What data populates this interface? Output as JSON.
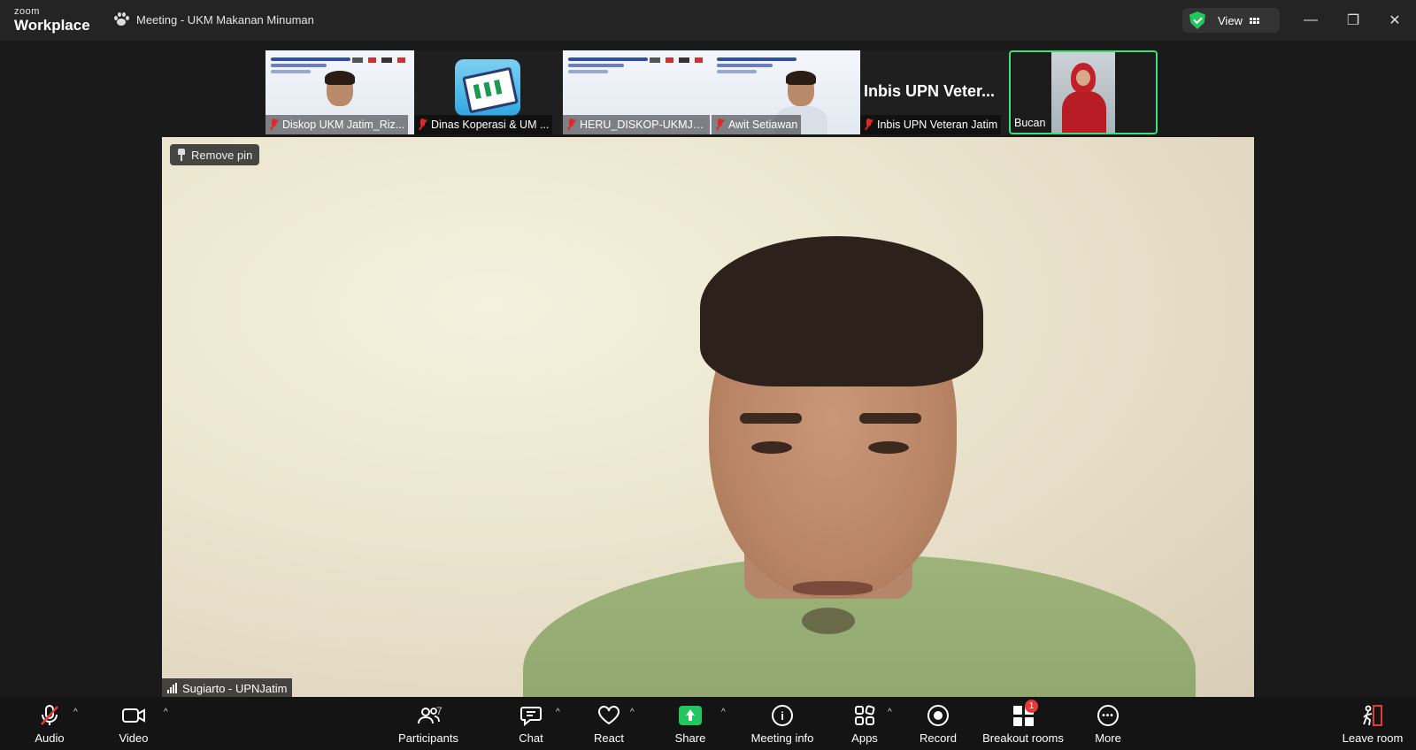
{
  "window": {
    "logo_small": "zoom",
    "logo_big": "Workplace",
    "meeting_title": "Meeting - UKM Makanan Minuman",
    "view_label": "View"
  },
  "participants_strip": [
    {
      "name": "Diskop UKM Jatim_Riz...",
      "muted": true,
      "kind": "slide-person"
    },
    {
      "name": "Dinas Koperasi & UM ...",
      "muted": true,
      "kind": "app-icon"
    },
    {
      "name": "HERU_DISKOP-UKMJA...",
      "muted": true,
      "kind": "slide"
    },
    {
      "name": "Awit Setiawan",
      "muted": true,
      "kind": "slide-person"
    },
    {
      "name": "Inbis UPN Veteran Jatim",
      "muted": true,
      "kind": "text",
      "display_text": "Inbis UPN Veter..."
    },
    {
      "name": "Bucan",
      "muted": false,
      "kind": "active-speaker"
    }
  ],
  "main_video": {
    "pin_label": "Remove pin",
    "speaker_name": "Sugiarto - UPNJatim"
  },
  "toolbar": {
    "audio": "Audio",
    "video": "Video",
    "participants": "Participants",
    "participants_count": "7",
    "chat": "Chat",
    "react": "React",
    "share": "Share",
    "meeting_info": "Meeting info",
    "apps": "Apps",
    "record": "Record",
    "breakout": "Breakout rooms",
    "breakout_badge": "1",
    "more": "More",
    "leave": "Leave room"
  },
  "colors": {
    "active_border": "#3ee07a",
    "share_green": "#22c55e",
    "muted_red": "#e02828",
    "badge_red": "#e53935"
  }
}
